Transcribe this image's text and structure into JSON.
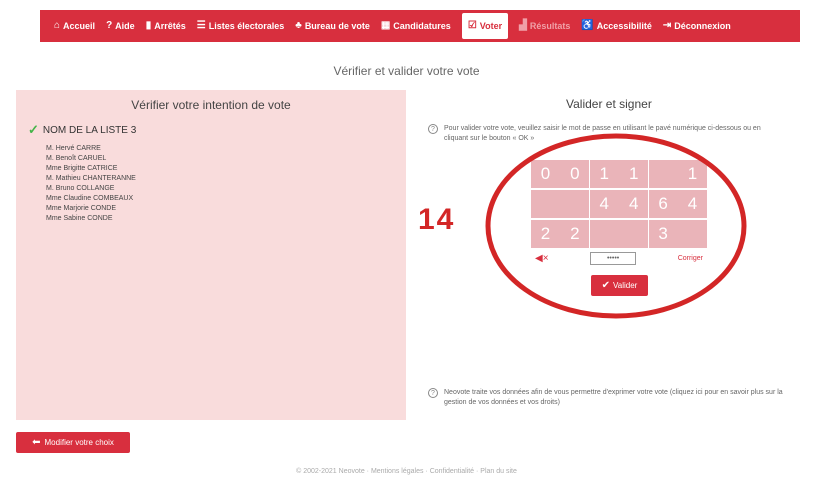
{
  "nav": {
    "items": [
      {
        "label": "Accueil",
        "icon": "home-icon",
        "glyph": "⌂"
      },
      {
        "label": "Aide",
        "icon": "help-icon",
        "glyph": "?"
      },
      {
        "label": "Arrêtés",
        "icon": "document-icon",
        "glyph": "▮"
      },
      {
        "label": "Listes électorales",
        "icon": "list-icon",
        "glyph": "☰"
      },
      {
        "label": "Bureau de vote",
        "icon": "people-icon",
        "glyph": "♣"
      },
      {
        "label": "Candidatures",
        "icon": "cards-icon",
        "glyph": "▦"
      },
      {
        "label": "Voter",
        "icon": "ballot-icon",
        "glyph": "☑"
      },
      {
        "label": "Résultats",
        "icon": "chart-icon",
        "glyph": "▟"
      },
      {
        "label": "Accessibilité",
        "icon": "accessibility-icon",
        "glyph": "♿"
      },
      {
        "label": "Déconnexion",
        "icon": "logout-icon",
        "glyph": "⇥"
      }
    ],
    "active_index": 6,
    "disabled_index": 7
  },
  "page": {
    "title": "Vérifier et valider votre vote"
  },
  "left": {
    "title": "Vérifier votre intention de vote",
    "list_name": "NOM DE LA LISTE 3",
    "candidates": [
      "M. Hervé CARRE",
      "M. Benoît CARUEL",
      "Mme Brigitte CATRICE",
      "M. Mathieu CHANTERANNE",
      "M. Bruno COLLANGE",
      "Mme Claudine COMBEAUX",
      "Mme Marjorie CONDE",
      "Mme Sabine CONDE"
    ]
  },
  "right": {
    "title": "Valider et signer",
    "instructions": "Pour valider votre vote, veuillez saisir le mot de passe en utilisant le pavé numérique ci-dessous ou en cliquant sur le bouton « OK »",
    "keypad": [
      "0",
      "0",
      "1",
      "1",
      "",
      "1",
      "",
      "",
      "4",
      "4",
      "6",
      "4",
      "2",
      "2",
      "",
      "",
      "3",
      ""
    ],
    "password_mask": "•••••",
    "correct_label": "Corriger",
    "validate_label": "Valider",
    "privacy_text": "Neovote traite vos données afin de vous permettre d'exprimer votre vote (cliquez ici pour en savoir plus sur la gestion de vos données et vos droits)"
  },
  "annotation": {
    "step_number": "14"
  },
  "modify_label": "Modifier votre choix",
  "footer": "© 2002-2021 Neovote · Mentions légales · Confidentialité · Plan du site",
  "colors": {
    "brand_red": "#d82f3e",
    "keypad_pink": "#eab4b9",
    "panel_pink": "#f9dcdc",
    "annotation_red": "#d32626",
    "check_green": "#44b449"
  }
}
